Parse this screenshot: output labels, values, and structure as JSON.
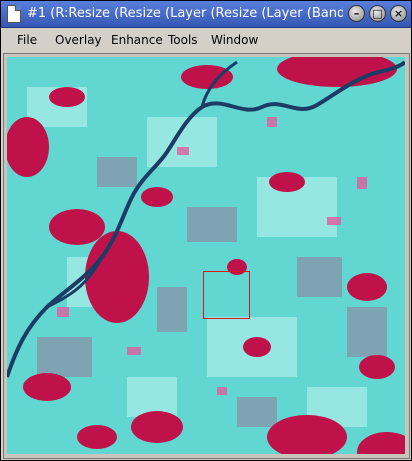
{
  "window": {
    "title": "#1 (R:Resize (Resize (Layer (Resize (Layer (Band",
    "controls": {
      "minimize": "minimize-icon",
      "maximize": "maximize-icon",
      "close": "close-icon"
    }
  },
  "menu": {
    "file": "File",
    "overlay": "Overlay",
    "enhance": "Enhance",
    "tools": "Tools",
    "window": "Window"
  },
  "image": {
    "type": "false-color satellite image",
    "colors": {
      "vegetation": "#c0124a",
      "bare_soil": "#5ee0dc",
      "water": "#1c3c64",
      "zoom_box": "#d81818"
    }
  }
}
